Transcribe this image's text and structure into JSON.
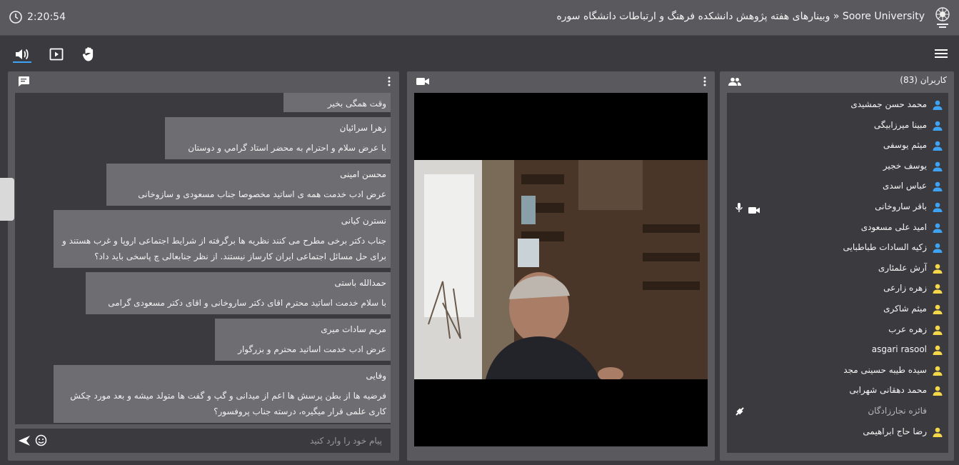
{
  "header": {
    "clock": "2:20:54",
    "title": "Soore University « وبینارهای هفته پژوهش دانشکده فرهنگ و ارتباطات دانشگاه سوره"
  },
  "toolbar": {
    "icons": [
      "speaker-icon",
      "play-box-icon",
      "raise-hand-icon",
      "menu-icon"
    ]
  },
  "chat": {
    "messages": [
      {
        "name": "",
        "lines": [
          "وقت همگی بخیر"
        ]
      },
      {
        "name": "زهرا سرائیان",
        "lines": [
          "با عرض سلام و احترام به محضر استاد گرامي و دوستان"
        ]
      },
      {
        "name": "محسن امینی",
        "lines": [
          "عرض ادب خدمت همه ی اساتید مخصوصا جناب مسعودی و سازوخانی"
        ]
      },
      {
        "name": "نسترن کیانی",
        "lines": [
          "جناب دکتر برخی مطرح می کنند نظریه ها برگرفته از شرایط اجتماعی اروپا و غرب هستند و",
          "برای حل مسائل اجتماعی ایران کارساز نیستند. از نظر جنابعالی چ پاسخی باید داد؟"
        ]
      },
      {
        "name": "حمدالله باستی",
        "lines": [
          "با سلام خدمت اساتید محترم اقای دکتر ساروخانی و اقای دکتر مسعودی گرامی"
        ]
      },
      {
        "name": "مریم سادات میری",
        "lines": [
          "عرض ادب خدمت اساتید محترم و بزرگوار"
        ]
      },
      {
        "name": "وفایی",
        "lines": [
          "فرضیه ها از بطن پرسش ها اعم از میدانی و گپ و گفت ها متولد میشه و بعد مورد چکش",
          "کاری علمی قرار میگیره، درسته جناب پروفسور؟"
        ]
      }
    ],
    "input_placeholder": "پیام خود را وارد کنید"
  },
  "users": {
    "header": "کاربران (83)",
    "list": [
      {
        "name": "محمد حسن جمشیدی",
        "role": "moderator"
      },
      {
        "name": "مبینا میرزابیگی",
        "role": "moderator"
      },
      {
        "name": "میثم یوسفی",
        "role": "moderator"
      },
      {
        "name": "یوسف خجیر",
        "role": "moderator"
      },
      {
        "name": "عباس اسدی",
        "role": "moderator"
      },
      {
        "name": "باقر ساروخانی",
        "role": "moderator"
      },
      {
        "name": "امید علی مسعودی",
        "role": "moderator"
      },
      {
        "name": "زکیه السادات طباطبایی",
        "role": "moderator"
      },
      {
        "name": "آرش علمئاری",
        "role": "viewer"
      },
      {
        "name": "زهره زارعی",
        "role": "viewer"
      },
      {
        "name": "میثم شاکری",
        "role": "viewer"
      },
      {
        "name": "زهره عرب",
        "role": "viewer"
      },
      {
        "name": "asgari rasool",
        "role": "viewer"
      },
      {
        "name": "سیده طیبه حسینی مجد",
        "role": "viewer"
      },
      {
        "name": "محمد دهقانی شهرابی",
        "role": "viewer"
      },
      {
        "name": "فائزه نجارزادگان",
        "role": "away"
      },
      {
        "name": "رضا حاج ابراهیمی",
        "role": "viewer"
      }
    ]
  },
  "colors": {
    "moderator": "#3fa3f5",
    "viewer": "#f5d84a",
    "accent": "#3fa3f5"
  }
}
